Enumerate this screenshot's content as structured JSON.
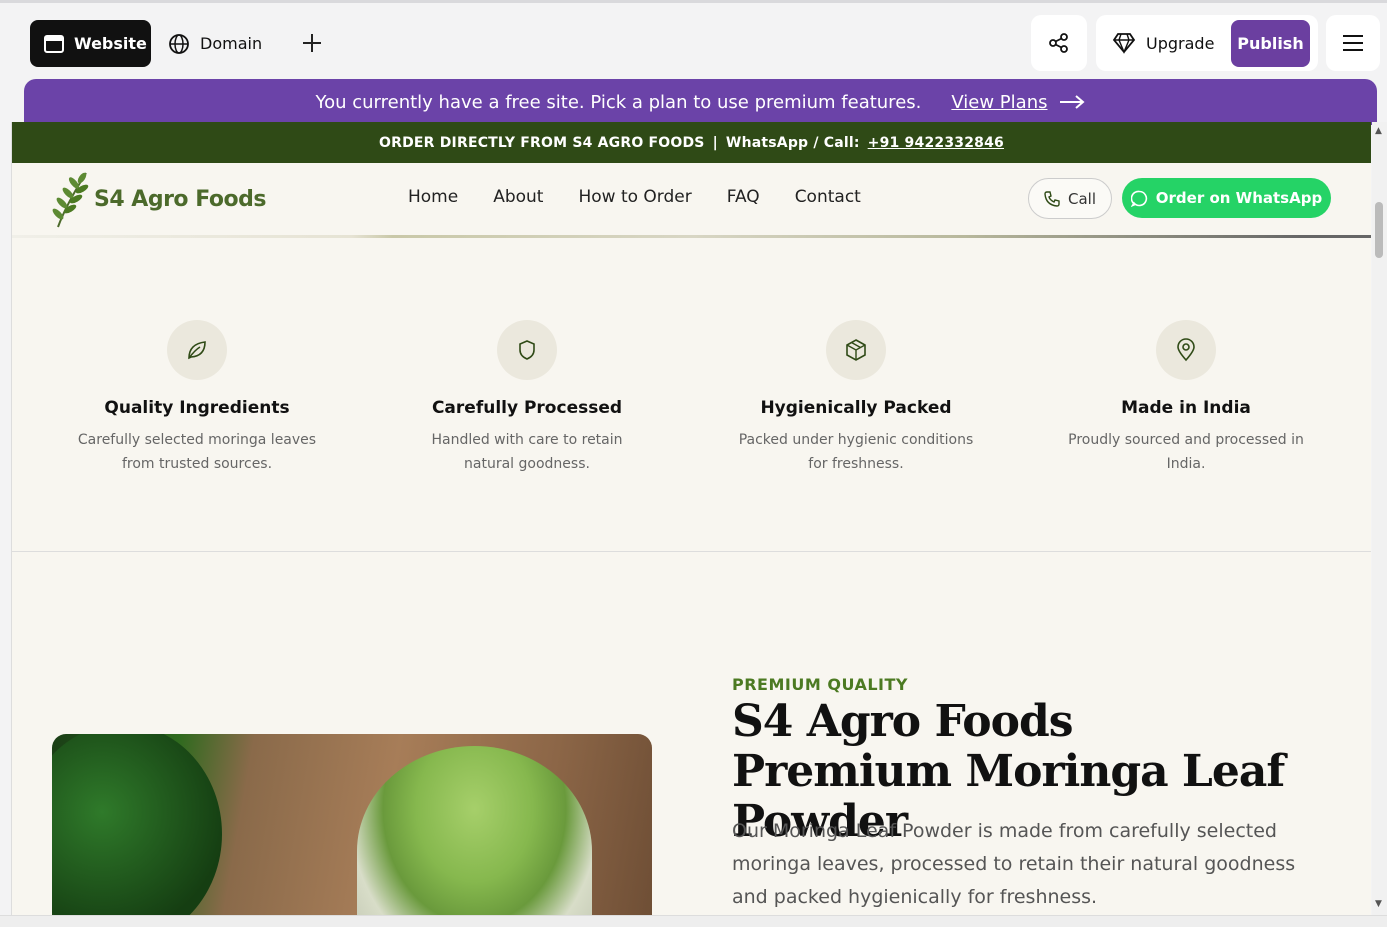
{
  "editor": {
    "tab_website": "Website",
    "tab_domain": "Domain",
    "upgrade_label": "Upgrade",
    "publish_label": "Publish"
  },
  "banner": {
    "text": "You currently have a free site. Pick a plan to use premium features.",
    "link": "View Plans"
  },
  "site": {
    "order_strip": {
      "lead": "ORDER DIRECTLY FROM S4 AGRO FOODS",
      "separator": "|",
      "contact_label": "WhatsApp / Call:",
      "phone": "+91 9422332846"
    },
    "logo_text": "S4 Agro Foods",
    "nav": [
      "Home",
      "About",
      "How to Order",
      "FAQ",
      "Contact"
    ],
    "call_label": "Call",
    "whatsapp_label": "Order on WhatsApp",
    "features": [
      {
        "title": "Quality Ingredients",
        "desc": "Carefully selected moringa leaves from trusted sources.",
        "icon": "leaf-icon"
      },
      {
        "title": "Carefully Processed",
        "desc": "Handled with care to retain natural goodness.",
        "icon": "shield-icon"
      },
      {
        "title": "Hygienically Packed",
        "desc": "Packed under hygienic conditions for freshness.",
        "icon": "box-icon"
      },
      {
        "title": "Made in India",
        "desc": "Proudly sourced and processed in India.",
        "icon": "location-pin-icon"
      }
    ],
    "product": {
      "kicker": "PREMIUM QUALITY",
      "title": "S4 Agro Foods Premium Moringa Leaf Powder",
      "desc": "Our Moringa Leaf Powder is made from carefully selected moringa leaves, processed to retain their natural goodness and packed hygienically for freshness."
    }
  },
  "colors": {
    "accent_purple": "#6b43a8",
    "order_strip_green": "#2f4a16",
    "whatsapp_green": "#25d366",
    "kicker_green": "#4c7a22"
  }
}
